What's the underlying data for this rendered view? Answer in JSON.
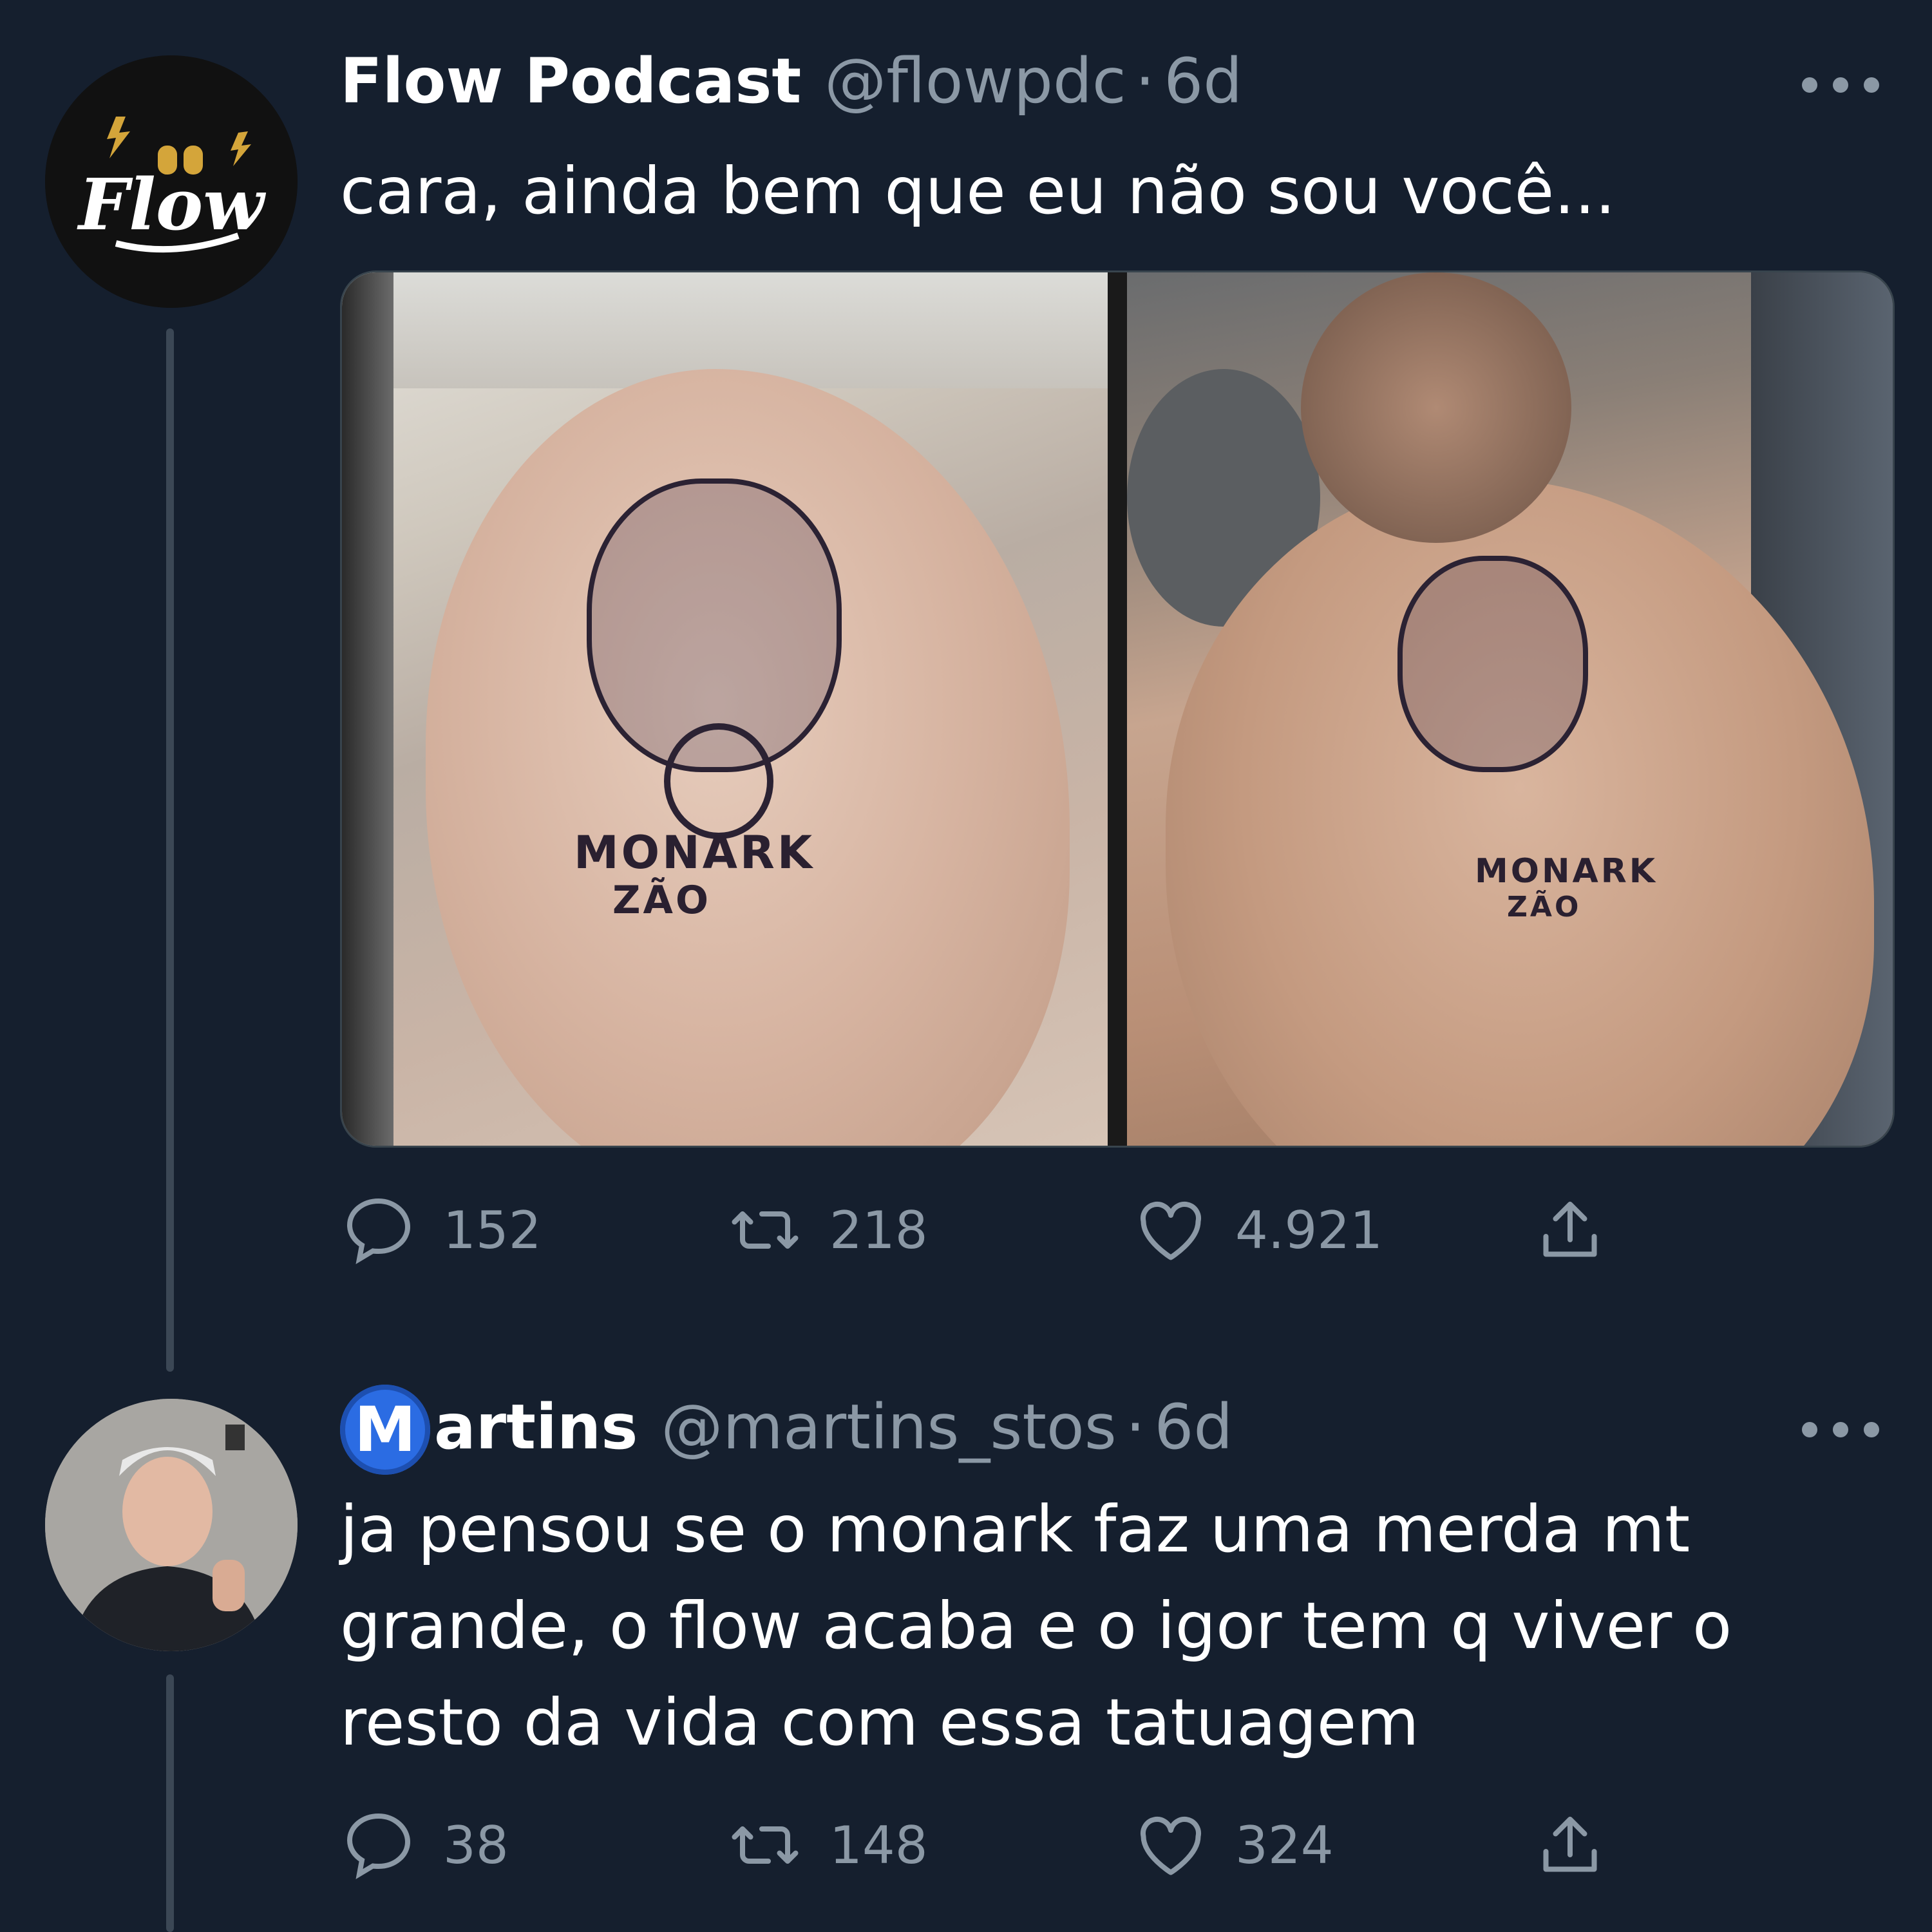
{
  "tweets": [
    {
      "name": "Flow Podcast",
      "handle": "@flowpdc",
      "separator": "·",
      "time": "6d",
      "text": "cara, ainda bem que eu não sou você...",
      "avatar_logo_text": "Flow",
      "media": {
        "left_tattoo_text": "MONARK",
        "left_tattoo_sub": "ZÃO",
        "right_tattoo_text": "MONARK",
        "right_tattoo_sub": "ZÃO"
      },
      "stats": {
        "replies": "152",
        "retweets": "218",
        "likes": "4.921"
      }
    },
    {
      "name_badge_letter": "M",
      "name_rest": "artins",
      "handle": "@martins_stos",
      "separator": "·",
      "time": "6d",
      "text_lines": [
        "ja pensou se o monark faz uma merda mt",
        "grande, o flow acaba e o igor tem q viver o",
        "resto da vida com essa tatuagem"
      ],
      "stats": {
        "replies": "38",
        "retweets": "148",
        "likes": "324"
      }
    }
  ],
  "icons": [
    "reply-icon",
    "retweet-icon",
    "like-icon",
    "share-icon",
    "more-icon"
  ],
  "colors": {
    "background": "#151f2e",
    "text": "#ffffff",
    "muted": "#8b98a5",
    "badge": "#2b6ce3",
    "divider": "#38444d"
  }
}
